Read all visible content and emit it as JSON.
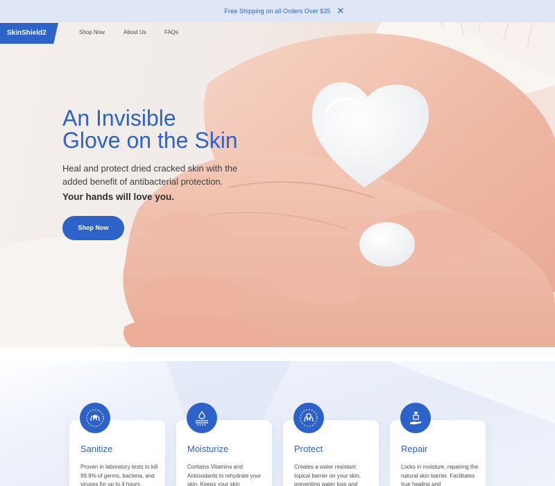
{
  "announcement": {
    "text": "Free Shipping on all Orders Over $35",
    "close_icon": "close-icon",
    "close_glyph": "✕"
  },
  "nav": {
    "logo": "SkinShield2",
    "links": [
      "Shop Now",
      "About Us",
      "FAQs"
    ]
  },
  "hero": {
    "title_line1": "An Invisible",
    "title_line2": "Glove on the Skin",
    "subtitle": "Heal and protect dried cracked skin with the added benefit of antibacterial protection.",
    "tagline": "Your hands will love you.",
    "cta": "Shop Now"
  },
  "features": [
    {
      "title": "Sanitize",
      "icon": "hands-sanitize-icon",
      "text": "Proven in laboratory tests to kill 99.9% of germs, bacteria, and viruses for up to 4 hours"
    },
    {
      "title": "Moisturize",
      "icon": "droplet-skin-icon",
      "text": "Contains Vitamins and Antioxidants to rehydrate your skin. Keeps your skin"
    },
    {
      "title": "Protect",
      "icon": "hands-shield-icon",
      "text": "Creates a water resistant topical barrier on your skin, preventing water loss and"
    },
    {
      "title": "Repair",
      "icon": "hand-pump-icon",
      "text": "Locks in moisture, repairing the natural skin barrier. Facilitates true healing and"
    }
  ],
  "colors": {
    "brand": "#2d63c8",
    "announcement_bg": "#dfe6f5"
  }
}
